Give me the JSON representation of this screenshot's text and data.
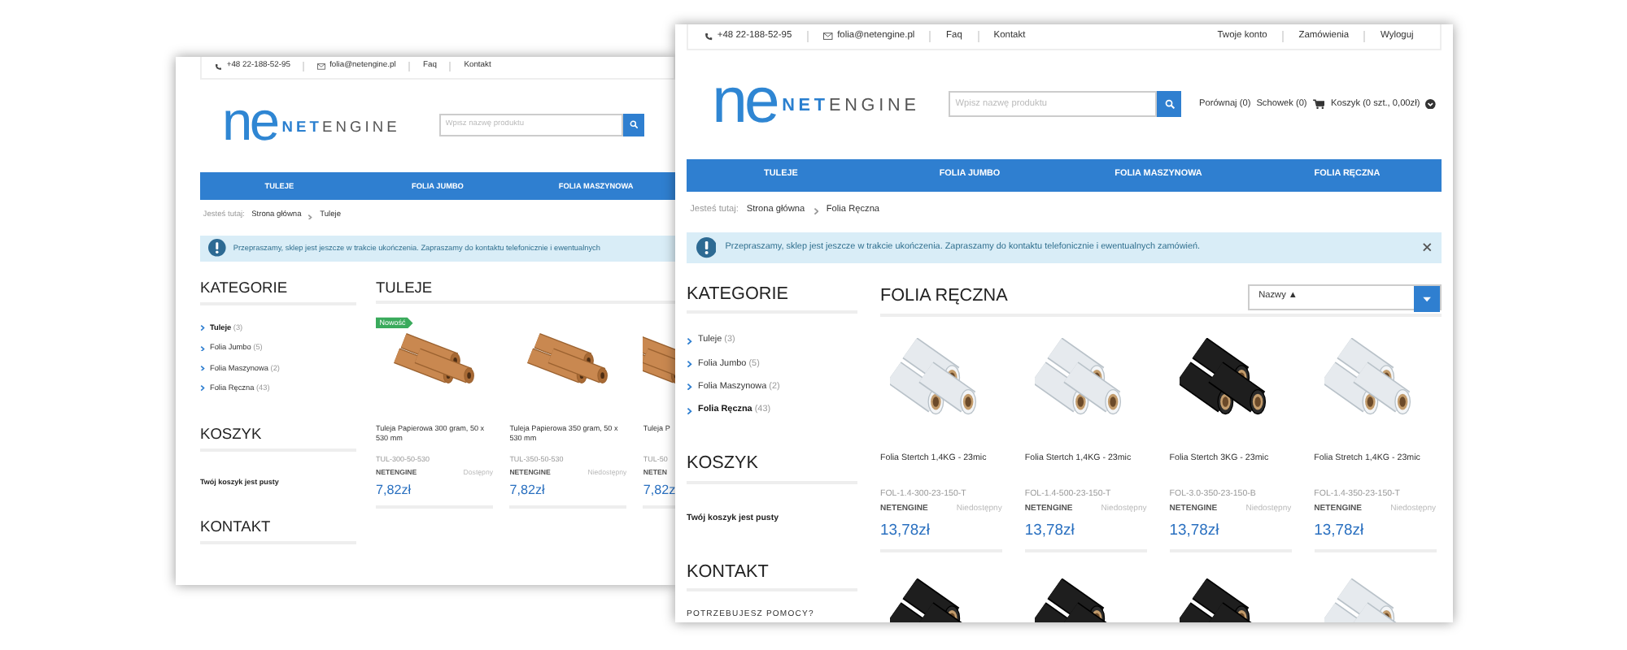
{
  "windows": [
    {
      "kind": "back",
      "top_bar": {
        "phone": "+48 22-188-52-95",
        "email": "folia@netengine.pl",
        "links": [
          "Faq",
          "Kontakt"
        ]
      },
      "logo": {
        "mark": "ne",
        "wordmark": "**NET**ENGINE"
      },
      "search": {
        "placeholder": "Wpisz nazwę produktu"
      },
      "nav": [
        "TULEJE",
        "FOLIA JUMBO",
        "FOLIA MASZYNOWA"
      ],
      "breadcrumb": {
        "label": "Jesteś tutaj:",
        "items": [
          "Strona główna",
          "Tuleje"
        ]
      },
      "alert": {
        "text": "Przepraszamy, sklep jest jeszcze w trakcie ukończenia. Zapraszamy do kontaktu telefonicznie i ewentualnych",
        "closable": false
      },
      "sidebar": {
        "categories_title": "KATEGORIE",
        "categories": [
          {
            "label": "Tuleje",
            "count": "(3)",
            "selected": true
          },
          {
            "label": "Folia Jumbo",
            "count": "(5)",
            "selected": false
          },
          {
            "label": "Folia Maszynowa",
            "count": "(2)",
            "selected": false
          },
          {
            "label": "Folia Ręczna",
            "count": "(43)",
            "selected": false
          }
        ],
        "cart_title": "KOSZYK",
        "cart_text": "Twój koszyk jest pusty",
        "contact_title": "KONTAKT"
      },
      "main": {
        "title": "TULEJE",
        "products": [
          {
            "kind": "tubes",
            "badge": "Nowość",
            "name": "Tuleja Papierowa 300 gram, 50 x 530 mm",
            "sku": "TUL-300-50-530",
            "brand": "NETENGINE",
            "availability": "Dostępny",
            "price": "7,82zł"
          },
          {
            "kind": "tubes",
            "name": "Tuleja Papierowa 350 gram, 50 x 530 mm",
            "sku": "TUL-350-50-530",
            "brand": "NETENGINE",
            "availability": "Niedostępny",
            "price": "7,82zł"
          },
          {
            "kind": "tubes",
            "name": "Tuleja P",
            "sku": "TUL-50",
            "brand": "NETEN",
            "price": "7,82z"
          }
        ]
      }
    },
    {
      "kind": "front",
      "top_bar": {
        "phone": "+48 22-188-52-95",
        "email": "folia@netengine.pl",
        "links": [
          "Faq",
          "Kontakt"
        ],
        "account_links": [
          "Twoje konto",
          "Zamówienia",
          "Wyloguj"
        ]
      },
      "logo": {
        "mark": "ne",
        "wordmark": "**NET**ENGINE"
      },
      "search": {
        "placeholder": "Wpisz nazwę produktu"
      },
      "shop_links": [
        "Porównaj (0)",
        "Schowek (0)"
      ],
      "cart": "Koszyk (0 szt., 0,00zł)",
      "nav": [
        "TULEJE",
        "FOLIA JUMBO",
        "FOLIA MASZYNOWA",
        "FOLIA RĘCZNA"
      ],
      "breadcrumb": {
        "label": "Jesteś tutaj:",
        "items": [
          "Strona główna",
          "Folia Ręczna"
        ]
      },
      "alert": {
        "text": "Przepraszamy, sklep jest jeszcze w trakcie ukończenia. Zapraszamy do kontaktu telefonicznie i ewentualnych zamówień.",
        "closable": true
      },
      "sidebar": {
        "categories_title": "KATEGORIE",
        "categories": [
          {
            "label": "Tuleje",
            "count": "(3)",
            "selected": false
          },
          {
            "label": "Folia Jumbo",
            "count": "(5)",
            "selected": false
          },
          {
            "label": "Folia Maszynowa",
            "count": "(2)",
            "selected": false
          },
          {
            "label": "Folia Ręczna",
            "count": "(43)",
            "selected": true
          }
        ],
        "cart_title": "KOSZYK",
        "cart_text": "Twój koszyk jest pusty",
        "contact_title": "KONTAKT",
        "contact_subtitle": "POTRZEBUJESZ POMOCY?"
      },
      "main": {
        "title": "FOLIA RĘCZNA",
        "sort": "Nazwy ▲",
        "products": [
          {
            "kind": "clear",
            "name": "Folia Stertch 1,4KG - 23mic",
            "sku": "FOL-1.4-300-23-150-T",
            "brand": "NETENGINE",
            "availability": "Niedostępny",
            "price": "13,78zł"
          },
          {
            "kind": "clear",
            "name": "Folia Stertch 1,4KG - 23mic",
            "sku": "FOL-1.4-500-23-150-T",
            "brand": "NETENGINE",
            "availability": "Niedostępny",
            "price": "13,78zł"
          },
          {
            "kind": "black",
            "name": "Folia Stertch 3KG - 23mic",
            "sku": "FOL-3.0-350-23-150-B",
            "brand": "NETENGINE",
            "availability": "Niedostępny",
            "price": "13,78zł"
          },
          {
            "kind": "clear",
            "name": "Folia Stretch 1,4KG - 23mic",
            "sku": "FOL-1.4-350-23-150-T",
            "brand": "NETENGINE",
            "availability": "Niedostępny",
            "price": "13,78zł"
          }
        ],
        "next_row": [
          {
            "kind": "black"
          },
          {
            "kind": "black"
          },
          {
            "kind": "black"
          },
          {
            "kind": "clear"
          }
        ]
      }
    }
  ]
}
